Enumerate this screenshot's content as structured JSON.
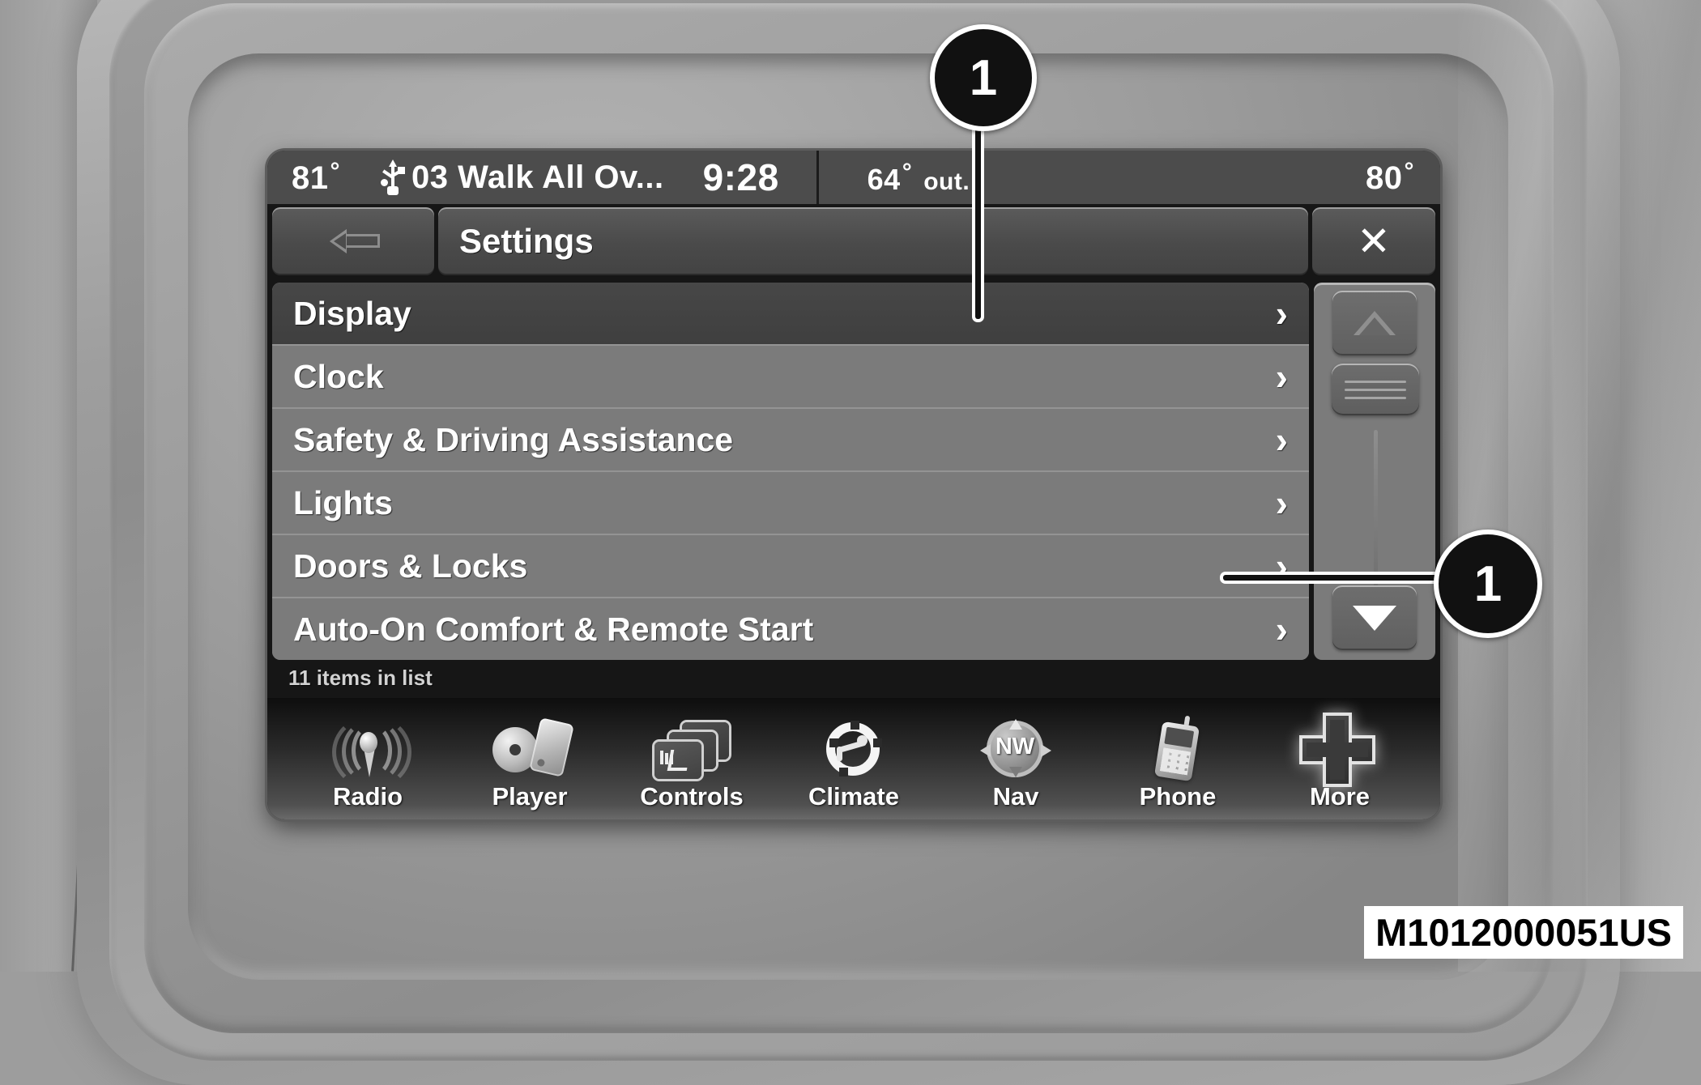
{
  "status_bar": {
    "temp_inside": "81",
    "degree": "°",
    "usb_icon": "usb-icon",
    "track": "03 Walk All Ov...",
    "clock": "9:28",
    "temp_outside": "64",
    "temp_outside_label": "out.",
    "temp_passenger": "80"
  },
  "title_bar": {
    "back_icon": "back-arrow-icon",
    "title": "Settings",
    "close_icon": "✕"
  },
  "menu": {
    "items": [
      {
        "label": "Display",
        "chevron": "›",
        "selected": true
      },
      {
        "label": "Clock",
        "chevron": "›",
        "selected": false
      },
      {
        "label": "Safety & Driving Assistance",
        "chevron": "›",
        "selected": false
      },
      {
        "label": "Lights",
        "chevron": "›",
        "selected": false
      },
      {
        "label": "Doors & Locks",
        "chevron": "›",
        "selected": false
      },
      {
        "label": "Auto-On Comfort & Remote Start",
        "chevron": "›",
        "selected": false
      }
    ],
    "item_count": "11 items in list"
  },
  "scrollbar": {
    "up_icon": "scroll-up-arrow-icon",
    "thumb_icon": "scroll-thumb-grip-icon",
    "down_icon": "scroll-down-arrow-icon"
  },
  "nav_bar": {
    "items": [
      {
        "label": "Radio",
        "icon": "radio-icon"
      },
      {
        "label": "Player",
        "icon": "player-icon"
      },
      {
        "label": "Controls",
        "icon": "controls-icon"
      },
      {
        "label": "Climate",
        "icon": "climate-icon"
      },
      {
        "label": "Nav",
        "icon": "nav-compass-icon"
      },
      {
        "label": "Phone",
        "icon": "phone-icon"
      },
      {
        "label": "More",
        "icon": "more-plus-icon"
      }
    ]
  },
  "callouts": [
    {
      "number": "1"
    },
    {
      "number": "1"
    }
  ],
  "part_number": "M1012000051US",
  "colors": {
    "screen_background": "#161616",
    "status_bar": "#4c4c4c",
    "list_row": "#7b7b7b",
    "list_row_selected": "#474747",
    "text": "#ffffff",
    "callout": "#111111"
  }
}
